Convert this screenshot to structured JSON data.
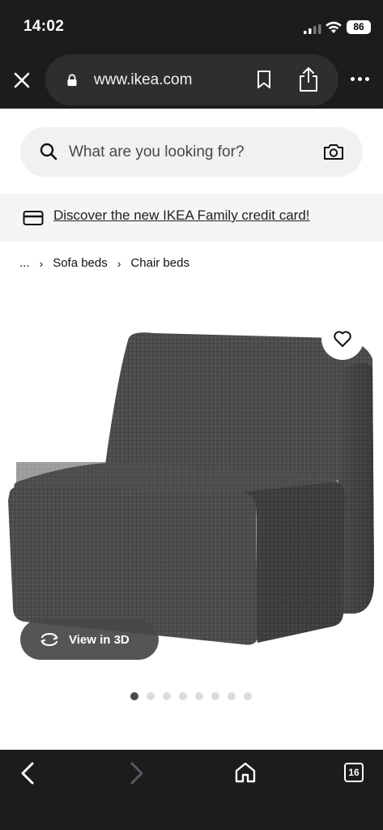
{
  "status_bar": {
    "time": "14:02",
    "battery": "86"
  },
  "browser": {
    "url": "www.ikea.com",
    "open_tabs": "16"
  },
  "search": {
    "placeholder": "What are you looking for?"
  },
  "banner": {
    "link_text": "Discover the new IKEA Family credit card!"
  },
  "breadcrumb": {
    "ellipsis": "...",
    "items": [
      "Sofa beds",
      "Chair beds"
    ]
  },
  "product": {
    "view3d_label": "View in 3D",
    "image_count": 8,
    "active_image": 1
  },
  "icons": {
    "close": "close-icon",
    "lock": "lock-icon",
    "bookmark": "bookmark-icon",
    "share": "share-icon",
    "more": "more-icon",
    "search": "search-icon",
    "camera": "camera-icon",
    "card": "credit-card-icon",
    "favourite": "heart-icon",
    "rotate": "rotate-3d-icon",
    "back": "back-icon",
    "forward": "forward-icon",
    "home": "home-icon",
    "tabs": "tabs-icon"
  },
  "colors": {
    "chrome": "#1c1c1e",
    "url_pill": "#2e2e31",
    "search_bg": "#f1f1f1",
    "banner_bg": "#f5f5f5",
    "chair": "#4a4b4d"
  }
}
